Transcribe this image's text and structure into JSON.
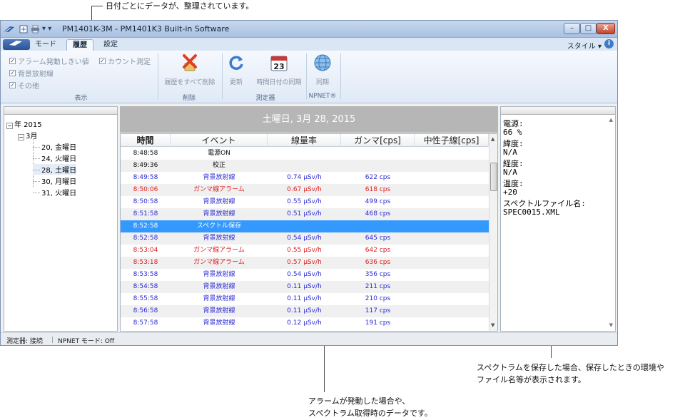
{
  "annotations": {
    "top": "日付ごとにデータが、整理されています。",
    "right": [
      "スペクトラムを保存した場合、保存したときの環境や",
      "ファイル名等が表示されます。"
    ],
    "bottom": [
      "アラームが発動した場合や、",
      "スペクトラム取得時のデータです。"
    ]
  },
  "window": {
    "title": "PM1401K-3M              - PM1401K3 Built-in Software",
    "controls": {
      "minimize": "–",
      "maximize": "□",
      "close": "X"
    }
  },
  "ribbon_tabs": [
    "モード",
    "履歴",
    "設定"
  ],
  "active_tab": "履歴",
  "style_menu": "スタイル ▾",
  "ribbon": {
    "display": {
      "label": "表示",
      "checks": [
        {
          "label": "アラーム発動しきい値",
          "checked": true
        },
        {
          "label": "背景放射線",
          "checked": true
        },
        {
          "label": "その他",
          "checked": true
        },
        {
          "label": "カウント測定",
          "checked": true
        }
      ]
    },
    "delete": {
      "label": "削除",
      "button": "履歴をすべて削除"
    },
    "device": {
      "label": "測定器",
      "refresh": "更新",
      "sync_time": "時間日付の同期",
      "calendar_day": "23"
    },
    "npnet": {
      "label": "NPNET®",
      "sync": "同期"
    }
  },
  "tree": {
    "year": "年 2015",
    "month": "3月",
    "days": [
      "20, 金曜日",
      "24, 火曜日",
      "28, 土曜日",
      "30, 月曜日",
      "31, 火曜日"
    ],
    "selected_index": 2
  },
  "date_header": "土曜日, 3月 28, 2015",
  "table": {
    "columns": [
      "時間",
      "イベント",
      "線量率",
      "ガンマ[cps]",
      "中性子線[cps]"
    ],
    "rows": [
      {
        "time": "8:48:58",
        "event": "電源ON",
        "dose": "",
        "gamma": "",
        "neutron": "",
        "kind": "normal"
      },
      {
        "time": "8:49:36",
        "event": "校正",
        "dose": "",
        "gamma": "",
        "neutron": "",
        "kind": "normal"
      },
      {
        "time": "8:49:58",
        "event": "背景放射線",
        "dose": "0.74 µSv/h",
        "gamma": "622 cps",
        "neutron": "",
        "kind": "bg"
      },
      {
        "time": "8:50:06",
        "event": "ガンマ線アラーム",
        "dose": "0.67 µSv/h",
        "gamma": "618 cps",
        "neutron": "",
        "kind": "alarm"
      },
      {
        "time": "8:50:58",
        "event": "背景放射線",
        "dose": "0.55 µSv/h",
        "gamma": "499 cps",
        "neutron": "",
        "kind": "bg"
      },
      {
        "time": "8:51:58",
        "event": "背景放射線",
        "dose": "0.51 µSv/h",
        "gamma": "468 cps",
        "neutron": "",
        "kind": "bg"
      },
      {
        "time": "8:52:58",
        "event": "スペクトル保存",
        "dose": "",
        "gamma": "",
        "neutron": "",
        "kind": "selected"
      },
      {
        "time": "8:52:58",
        "event": "背景放射線",
        "dose": "0.54 µSv/h",
        "gamma": "645 cps",
        "neutron": "",
        "kind": "bg"
      },
      {
        "time": "8:53:04",
        "event": "ガンマ線アラーム",
        "dose": "0.55 µSv/h",
        "gamma": "642 cps",
        "neutron": "",
        "kind": "alarm"
      },
      {
        "time": "8:53:18",
        "event": "ガンマ線アラーム",
        "dose": "0.57 µSv/h",
        "gamma": "636 cps",
        "neutron": "",
        "kind": "alarm"
      },
      {
        "time": "8:53:58",
        "event": "背景放射線",
        "dose": "0.54 µSv/h",
        "gamma": "356 cps",
        "neutron": "",
        "kind": "bg"
      },
      {
        "time": "8:54:58",
        "event": "背景放射線",
        "dose": "0.11 µSv/h",
        "gamma": "211 cps",
        "neutron": "",
        "kind": "bg"
      },
      {
        "time": "8:55:58",
        "event": "背景放射線",
        "dose": "0.11 µSv/h",
        "gamma": "210 cps",
        "neutron": "",
        "kind": "bg"
      },
      {
        "time": "8:56:58",
        "event": "背景放射線",
        "dose": "0.11 µSv/h",
        "gamma": "117 cps",
        "neutron": "",
        "kind": "bg"
      },
      {
        "time": "8:57:58",
        "event": "背景放射線",
        "dose": "0.12 µSv/h",
        "gamma": "191 cps",
        "neutron": "",
        "kind": "bg"
      }
    ]
  },
  "detail": [
    "電源:",
    "66 %",
    "緯度:",
    "N/A",
    "経度:",
    "N/A",
    "温度:",
    "+20",
    "スペクトルファイル名:",
    "SPEC0015.XML"
  ],
  "status": {
    "device": "測定器: 接続",
    "npnet": "NPNET モード: Off"
  },
  "colors": {
    "bg_event": "#2b2bd6",
    "alarm_event": "#e02020",
    "selection": "#3399ff"
  }
}
